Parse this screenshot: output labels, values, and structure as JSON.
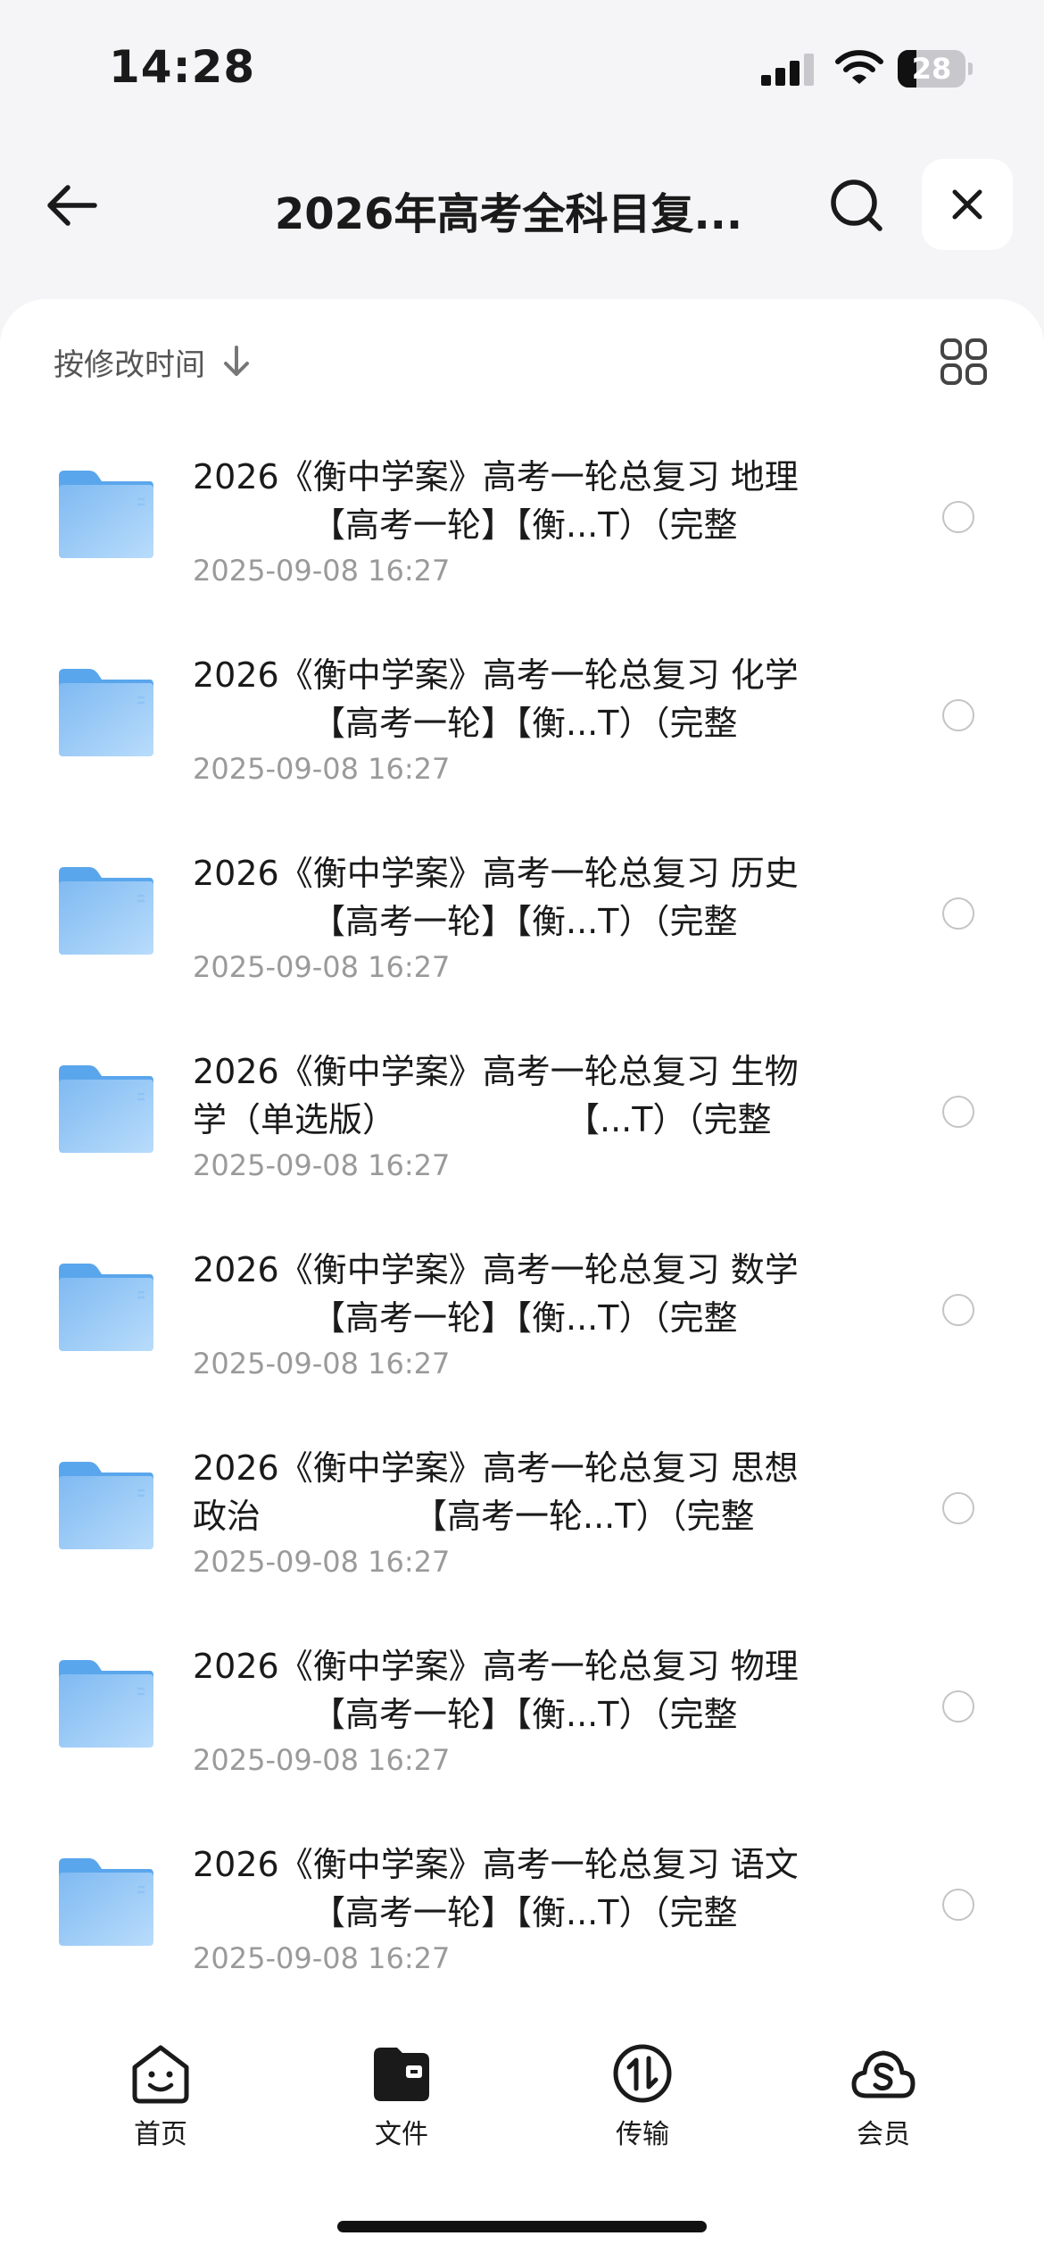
{
  "status_bar": {
    "time": "14:28",
    "battery": "28",
    "battery_level": 0.28
  },
  "nav": {
    "title": "2026年高考全科目复...",
    "back_icon": "arrow-left-icon",
    "search_icon": "search-icon",
    "close_icon": "close-icon"
  },
  "toolbar": {
    "sort_label": "按修改时间",
    "sort_icon": "arrow-down-icon",
    "view_icon": "grid-view-icon"
  },
  "files": [
    {
      "line1": "2026《衡中学案》高考一轮总复习 地理",
      "line2": "　　　　【高考一轮】【衡...T）（完整",
      "date": "2025-09-08 16:27"
    },
    {
      "line1": "2026《衡中学案》高考一轮总复习 化学",
      "line2": "　　　　【高考一轮】【衡...T）（完整",
      "date": "2025-09-08 16:27"
    },
    {
      "line1": "2026《衡中学案》高考一轮总复习 历史",
      "line2": "　　　　【高考一轮】【衡...T）（完整",
      "date": "2025-09-08 16:27"
    },
    {
      "line1": "2026《衡中学案》高考一轮总复习 生物",
      "line2": "学（单选版）　　　　　　【...T）（完整",
      "date": "2025-09-08 16:27"
    },
    {
      "line1": "2026《衡中学案》高考一轮总复习 数学",
      "line2": "　　　　【高考一轮】【衡...T）（完整",
      "date": "2025-09-08 16:27"
    },
    {
      "line1": "2026《衡中学案》高考一轮总复习 思想",
      "line2": "政治　　　　　【高考一轮...T）（完整",
      "date": "2025-09-08 16:27"
    },
    {
      "line1": "2026《衡中学案》高考一轮总复习 物理",
      "line2": "　　　　【高考一轮】【衡...T）（完整",
      "date": "2025-09-08 16:27"
    },
    {
      "line1": "2026《衡中学案》高考一轮总复习 语文",
      "line2": "　　　　【高考一轮】【衡...T）（完整",
      "date": "2025-09-08 16:27"
    }
  ],
  "tabs": [
    {
      "label": "首页",
      "icon": "home-smile-icon"
    },
    {
      "label": "文件",
      "icon": "folder-icon",
      "active": true
    },
    {
      "label": "传输",
      "icon": "transfer-icon"
    },
    {
      "label": "会员",
      "icon": "vip-cloud-icon"
    }
  ],
  "colors": {
    "background": "#f5f5f7",
    "card": "#ffffff",
    "folder_light": "#b9dcfb",
    "folder_dark": "#7fbaf2",
    "date_text": "#9a9a9a"
  }
}
